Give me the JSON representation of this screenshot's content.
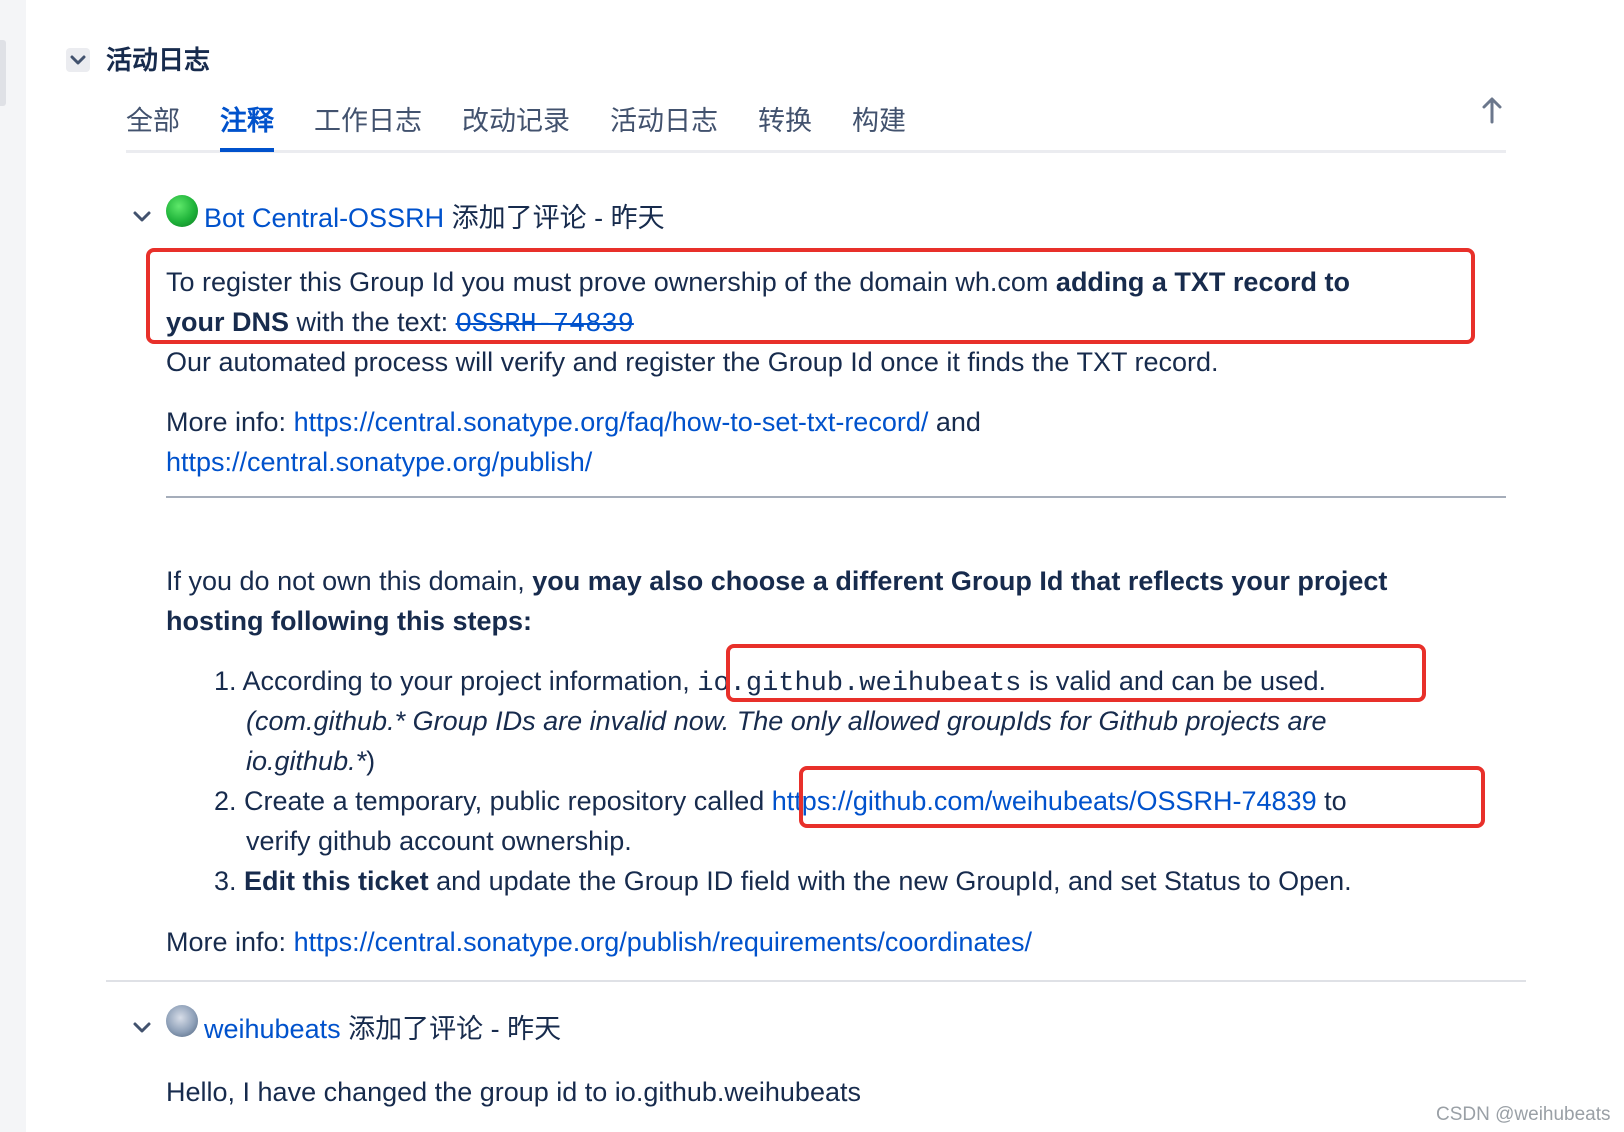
{
  "section": {
    "title": "活动日志"
  },
  "tabs": [
    {
      "label": "全部"
    },
    {
      "label": "注释"
    },
    {
      "label": "工作日志"
    },
    {
      "label": "改动记录"
    },
    {
      "label": "活动日志"
    },
    {
      "label": "转换"
    },
    {
      "label": "构建"
    }
  ],
  "comments": [
    {
      "author": "Bot Central-OSSRH",
      "action": " 添加了评论 - 昨天",
      "p1_a": "To register this Group Id you must prove ownership of the domain wh.com ",
      "p1_b": "adding a TXT record to",
      "p1_c": "your DNS",
      "p1_d": " with the text: ",
      "p1_code": "OSSRH-74839",
      "p2": "Our automated process will verify and register the Group Id once it finds the TXT record.",
      "more_info_label": "More info: ",
      "link1": "https://central.sonatype.org/faq/how-to-set-txt-record/",
      "and": " and",
      "link2": "https://central.sonatype.org/publish/",
      "p3_a": "If you do not own this domain, ",
      "p3_b": "you may also choose a different Group Id that reflects your project",
      "p3_c": "hosting following this steps:",
      "steps": [
        {
          "num": "1.",
          "a": " According to your project information, ",
          "code": "io.github.weihubeats",
          "b": " is valid and can be used.",
          "italic_line1": "(com.github.* Group IDs are invalid now. The only allowed groupIds for Github projects are",
          "italic_line2": "io.github.*",
          "close": ")"
        },
        {
          "num": "2.",
          "a": " Create a temporary, public repository called ",
          "link": "https://github.com/weihubeats/OSSRH-74839",
          "b": " to",
          "line2": "verify github account ownership."
        },
        {
          "num": "3.",
          "bold": " Edit this ticket",
          "rest": " and update the Group ID field with the new GroupId, and set Status to Open."
        }
      ],
      "more_info2_label": "More info: ",
      "link3": "https://central.sonatype.org/publish/requirements/coordinates/"
    },
    {
      "author": "weihubeats",
      "action": " 添加了评论 - 昨天",
      "body": "Hello, I have changed the group id to io.github.weihubeats"
    }
  ],
  "watermark": "CSDN @weihubeats",
  "icons": {
    "section_toggle": "chevron-down-icon",
    "scroll_top": "arrow-up-icon",
    "comment_toggle": "chevron-down-icon"
  },
  "colors": {
    "link": "#0052cc",
    "text": "#172b4d",
    "highlight_box": "#e8302a"
  }
}
